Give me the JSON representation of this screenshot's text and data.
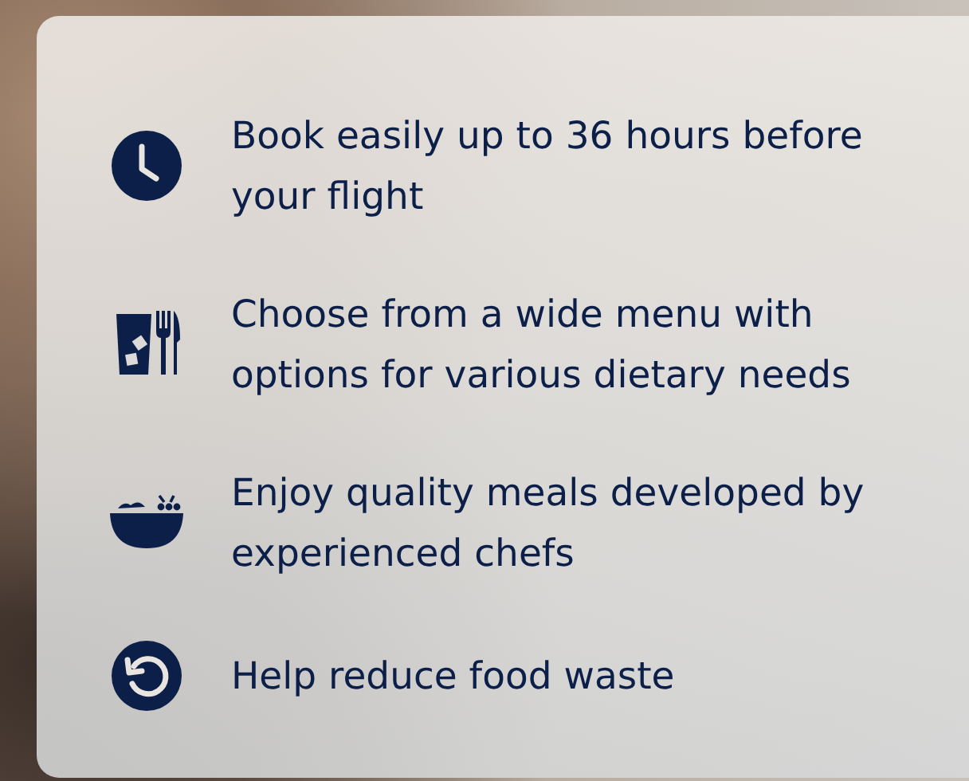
{
  "features": [
    {
      "kind": "clock",
      "text": "Book easily up to 36 hours before your flight"
    },
    {
      "kind": "drink-cutlery",
      "text": "Choose from a wide menu with options for various dietary needs"
    },
    {
      "kind": "bowl",
      "text": "Enjoy quality meals developed by experienced chefs"
    },
    {
      "kind": "refresh",
      "text": "Help reduce food waste"
    }
  ]
}
